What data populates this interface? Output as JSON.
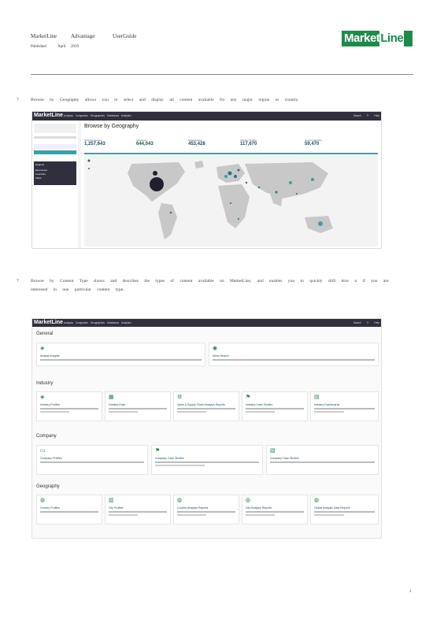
{
  "header": {
    "brand": "MarketLine",
    "product": "Advantage",
    "doc": "UserGuide",
    "published_label": "Published",
    "month": "April",
    "year": "2019",
    "logo_text": "Market",
    "logo_line": "Line"
  },
  "bullets": [
    {
      "marker": "?",
      "text": "Browse by Geography allows you to select and display all content available for any major region or country."
    },
    {
      "marker": "?",
      "text_line1": "Browse by Content Type shows and describes the types of content available on MarketLine, and enables you to quickly drill dow n if you are",
      "text_line2": "interested in one particular content type."
    }
  ],
  "screenshot1": {
    "logo": "MarketLine",
    "nav": "Analysis  Companies  Geographies  Databases  Analytics",
    "nav_right": "Search  ☰  Help",
    "title": "Browse by Geography",
    "stats": [
      {
        "label": "Total Companies",
        "value": "1,257,643"
      },
      {
        "label": "Industries",
        "value": "644,043"
      },
      {
        "label": "Geographies",
        "value": "453,428"
      },
      {
        "label": "Industry Profiles",
        "value": "117,670"
      },
      {
        "label": "Country Reports",
        "value": "59,470"
      }
    ],
    "sidebar": [
      "Regions",
      "Economies",
      "Countries",
      "Cities"
    ]
  },
  "screenshot2": {
    "logo": "MarketLine",
    "nav": "Analysis  Companies  Geographies  Databases  Analytics",
    "nav_right": "Search  ☰  Help",
    "sections": [
      {
        "title": "General",
        "cards": [
          "Analyst Insights",
          "News Search"
        ]
      },
      {
        "title": "Industry",
        "cards": [
          "Industry Profiles",
          "Industry Data",
          "Value & Supply Chain Analysis Reports",
          "Industry Case Studies",
          "Industry Dashboards"
        ]
      },
      {
        "title": "Company",
        "cards": [
          "Company Profiles",
          "Company Case Studies",
          "Company Case Studies"
        ]
      },
      {
        "title": "Geography",
        "cards": [
          "Country Profiles",
          "City Profiles",
          "Country Analysis Reports",
          "City Analysis Reports",
          "Global Analysis Data Reports"
        ]
      }
    ]
  },
  "page_number": "4",
  "colors": {
    "brand_green": "#1f8a4c",
    "nav_dark": "#2f2f3d",
    "teal": "#38a0a8"
  }
}
